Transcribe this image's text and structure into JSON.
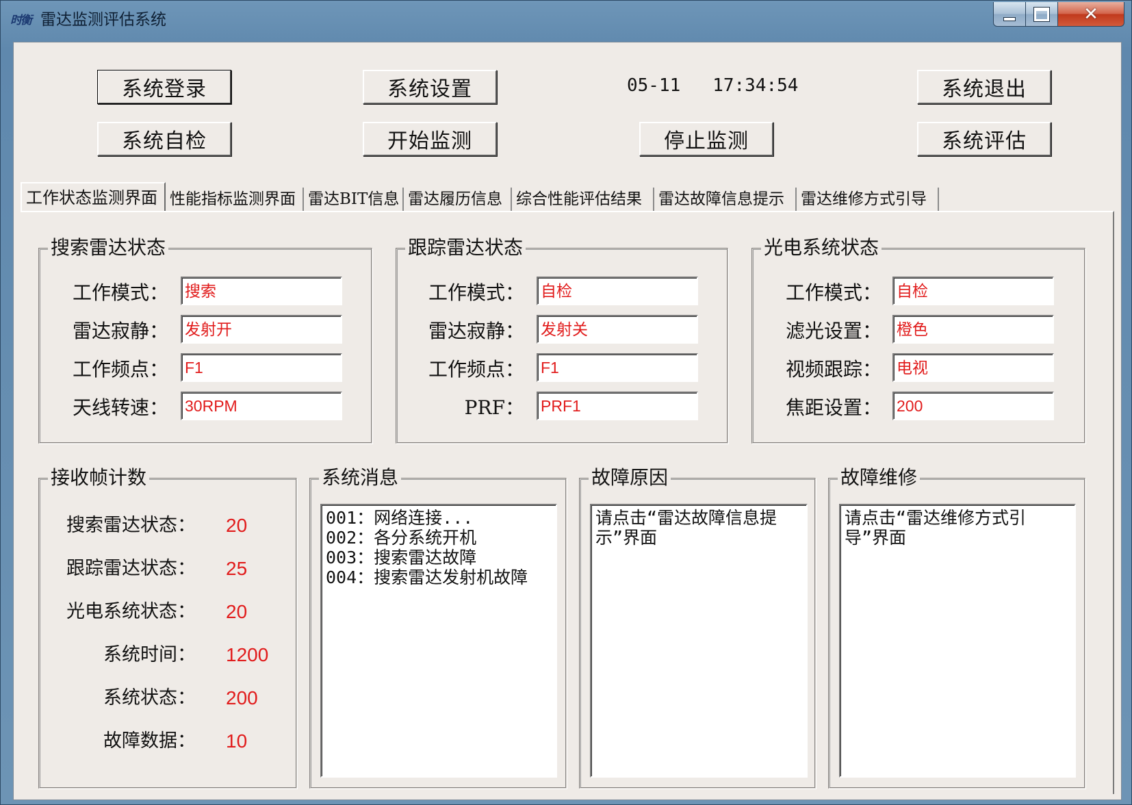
{
  "window": {
    "icon_text": "时衡",
    "title": "雷达监测评估系统"
  },
  "toolbar": {
    "login": "系统登录",
    "settings": "系统设置",
    "datetime": "05-11   17:34:54",
    "exit": "系统退出",
    "self_check": "系统自检",
    "start_monitor": "开始监测",
    "stop_monitor": "停止监测",
    "evaluate": "系统评估"
  },
  "tabs": [
    {
      "label": "工作状态监测界面",
      "active": true
    },
    {
      "label": "性能指标监测界面"
    },
    {
      "label": "雷达BIT信息"
    },
    {
      "label": "雷达履历信息"
    },
    {
      "label": "综合性能评估结果"
    },
    {
      "label": "雷达故障信息提示"
    },
    {
      "label": "雷达维修方式引导"
    }
  ],
  "search_radar": {
    "title": "搜索雷达状态",
    "fields": [
      {
        "label": "工作模式：",
        "value": "搜索"
      },
      {
        "label": "雷达寂静：",
        "value": "发射开"
      },
      {
        "label": "工作频点：",
        "value": "F1"
      },
      {
        "label": "天线转速：",
        "value": "30RPM"
      }
    ]
  },
  "track_radar": {
    "title": "跟踪雷达状态",
    "fields": [
      {
        "label": "工作模式：",
        "value": "自检"
      },
      {
        "label": "雷达寂静：",
        "value": "发射关"
      },
      {
        "label": "工作频点：",
        "value": "F1"
      },
      {
        "label": "PRF：",
        "value": "PRF1"
      }
    ]
  },
  "eo_system": {
    "title": "光电系统状态",
    "fields": [
      {
        "label": "工作模式：",
        "value": "自检"
      },
      {
        "label": "滤光设置：",
        "value": "橙色"
      },
      {
        "label": "视频跟踪：",
        "value": "电视"
      },
      {
        "label": "焦距设置：",
        "value": "200"
      }
    ]
  },
  "frame_count": {
    "title": "接收帧计数",
    "rows": [
      {
        "label": "搜索雷达状态：",
        "value": "20"
      },
      {
        "label": "跟踪雷达状态：",
        "value": "25"
      },
      {
        "label": "光电系统状态：",
        "value": "20"
      },
      {
        "label": "系统时间：",
        "value": "1200"
      },
      {
        "label": "系统状态：",
        "value": "200"
      },
      {
        "label": "故障数据：",
        "value": "10"
      }
    ]
  },
  "system_messages": {
    "title": "系统消息",
    "lines": [
      "001：网络连接...",
      "002：各分系统开机",
      "003：搜索雷达故障",
      "004：搜索雷达发射机故障"
    ]
  },
  "fault_cause": {
    "title": "故障原因",
    "text": "请点击“雷达故障信息提示”界面"
  },
  "fault_repair": {
    "title": "故障维修",
    "text": "请点击“雷达维修方式引导”界面"
  }
}
